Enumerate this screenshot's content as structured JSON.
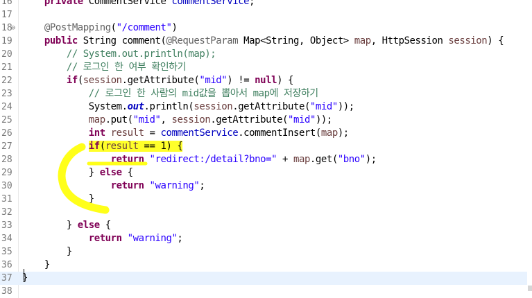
{
  "editor": {
    "lines": [
      {
        "n": "16",
        "segs": [
          {
            "t": "    "
          },
          {
            "t": "private",
            "c": "kw"
          },
          {
            "t": " CommentService "
          },
          {
            "t": "commentService",
            "c": "fld"
          },
          {
            "t": ";"
          }
        ]
      },
      {
        "n": "17",
        "segs": [
          {
            "t": ""
          }
        ]
      },
      {
        "n": "18",
        "segs": [
          {
            "t": "    "
          },
          {
            "t": "@PostMapping",
            "c": "ann"
          },
          {
            "t": "("
          },
          {
            "t": "\"/comment\"",
            "c": "str"
          },
          {
            "t": ")"
          }
        ]
      },
      {
        "n": "19",
        "segs": [
          {
            "t": "    "
          },
          {
            "t": "public",
            "c": "kw"
          },
          {
            "t": " String comment("
          },
          {
            "t": "@RequestParam",
            "c": "ann"
          },
          {
            "t": " Map<String, Object> "
          },
          {
            "t": "map",
            "c": "var"
          },
          {
            "t": ", HttpSession "
          },
          {
            "t": "session",
            "c": "var"
          },
          {
            "t": ") {"
          }
        ]
      },
      {
        "n": "20",
        "segs": [
          {
            "t": "        "
          },
          {
            "t": "// System.out.println(map);",
            "c": "cm"
          }
        ]
      },
      {
        "n": "21",
        "segs": [
          {
            "t": "        "
          },
          {
            "t": "// 로그인 한 여부 확인하기",
            "c": "cm"
          }
        ]
      },
      {
        "n": "22",
        "segs": [
          {
            "t": "        "
          },
          {
            "t": "if",
            "c": "kw"
          },
          {
            "t": "("
          },
          {
            "t": "session",
            "c": "var"
          },
          {
            "t": ".getAttribute("
          },
          {
            "t": "\"mid\"",
            "c": "str"
          },
          {
            "t": ") != "
          },
          {
            "t": "null",
            "c": "kw"
          },
          {
            "t": ") {"
          }
        ]
      },
      {
        "n": "23",
        "segs": [
          {
            "t": "            "
          },
          {
            "t": "// 로그인 한 사람의 mid값을 뽑아서 map에 저장하기",
            "c": "cm"
          }
        ]
      },
      {
        "n": "24",
        "segs": [
          {
            "t": "            System."
          },
          {
            "t": "out",
            "c": "st"
          },
          {
            "t": ".println("
          },
          {
            "t": "session",
            "c": "var"
          },
          {
            "t": ".getAttribute("
          },
          {
            "t": "\"mid\"",
            "c": "str"
          },
          {
            "t": "));"
          }
        ]
      },
      {
        "n": "25",
        "segs": [
          {
            "t": "            "
          },
          {
            "t": "map",
            "c": "var"
          },
          {
            "t": ".put("
          },
          {
            "t": "\"mid\"",
            "c": "str"
          },
          {
            "t": ", "
          },
          {
            "t": "session",
            "c": "var"
          },
          {
            "t": ".getAttribute("
          },
          {
            "t": "\"mid\"",
            "c": "str"
          },
          {
            "t": "));"
          }
        ]
      },
      {
        "n": "26",
        "segs": [
          {
            "t": "            "
          },
          {
            "t": "int",
            "c": "kw"
          },
          {
            "t": " "
          },
          {
            "t": "result",
            "c": "var"
          },
          {
            "t": " = "
          },
          {
            "t": "commentService",
            "c": "fld"
          },
          {
            "t": ".commentInsert("
          },
          {
            "t": "map",
            "c": "var"
          },
          {
            "t": ");"
          }
        ]
      },
      {
        "n": "27",
        "segs": [
          {
            "t": "            "
          },
          {
            "t": "if",
            "c": "kw hl"
          },
          {
            "t": "(",
            "c": "hl"
          },
          {
            "t": "result",
            "c": "var hl"
          },
          {
            "t": " == 1) {",
            "c": "hl"
          }
        ]
      },
      {
        "n": "28",
        "segs": [
          {
            "t": "                "
          },
          {
            "t": "return",
            "c": "kw"
          },
          {
            "t": " "
          },
          {
            "t": "\"redirect:/detail?bno=\"",
            "c": "str"
          },
          {
            "t": " + "
          },
          {
            "t": "map",
            "c": "var"
          },
          {
            "t": ".get("
          },
          {
            "t": "\"bno\"",
            "c": "str"
          },
          {
            "t": ");"
          }
        ]
      },
      {
        "n": "29",
        "segs": [
          {
            "t": "            } "
          },
          {
            "t": "else",
            "c": "kw"
          },
          {
            "t": " {"
          }
        ]
      },
      {
        "n": "30",
        "segs": [
          {
            "t": "                "
          },
          {
            "t": "return",
            "c": "kw"
          },
          {
            "t": " "
          },
          {
            "t": "\"warning\"",
            "c": "str"
          },
          {
            "t": ";"
          }
        ]
      },
      {
        "n": "31",
        "segs": [
          {
            "t": "            }"
          }
        ]
      },
      {
        "n": "32",
        "segs": [
          {
            "t": ""
          }
        ]
      },
      {
        "n": "33",
        "segs": [
          {
            "t": "        } "
          },
          {
            "t": "else",
            "c": "kw"
          },
          {
            "t": " {"
          }
        ]
      },
      {
        "n": "34",
        "segs": [
          {
            "t": "            "
          },
          {
            "t": "return",
            "c": "kw"
          },
          {
            "t": " "
          },
          {
            "t": "\"warning\"",
            "c": "str"
          },
          {
            "t": ";"
          }
        ]
      },
      {
        "n": "35",
        "segs": [
          {
            "t": "        }"
          }
        ]
      },
      {
        "n": "36",
        "segs": [
          {
            "t": "    }"
          }
        ]
      },
      {
        "n": "37",
        "segs": [
          {
            "t": "}"
          }
        ]
      },
      {
        "n": "38",
        "segs": [
          {
            "t": ""
          }
        ]
      }
    ],
    "fold_marker": "⊖",
    "current_line": "37",
    "highlight_color": "#ffff00"
  }
}
